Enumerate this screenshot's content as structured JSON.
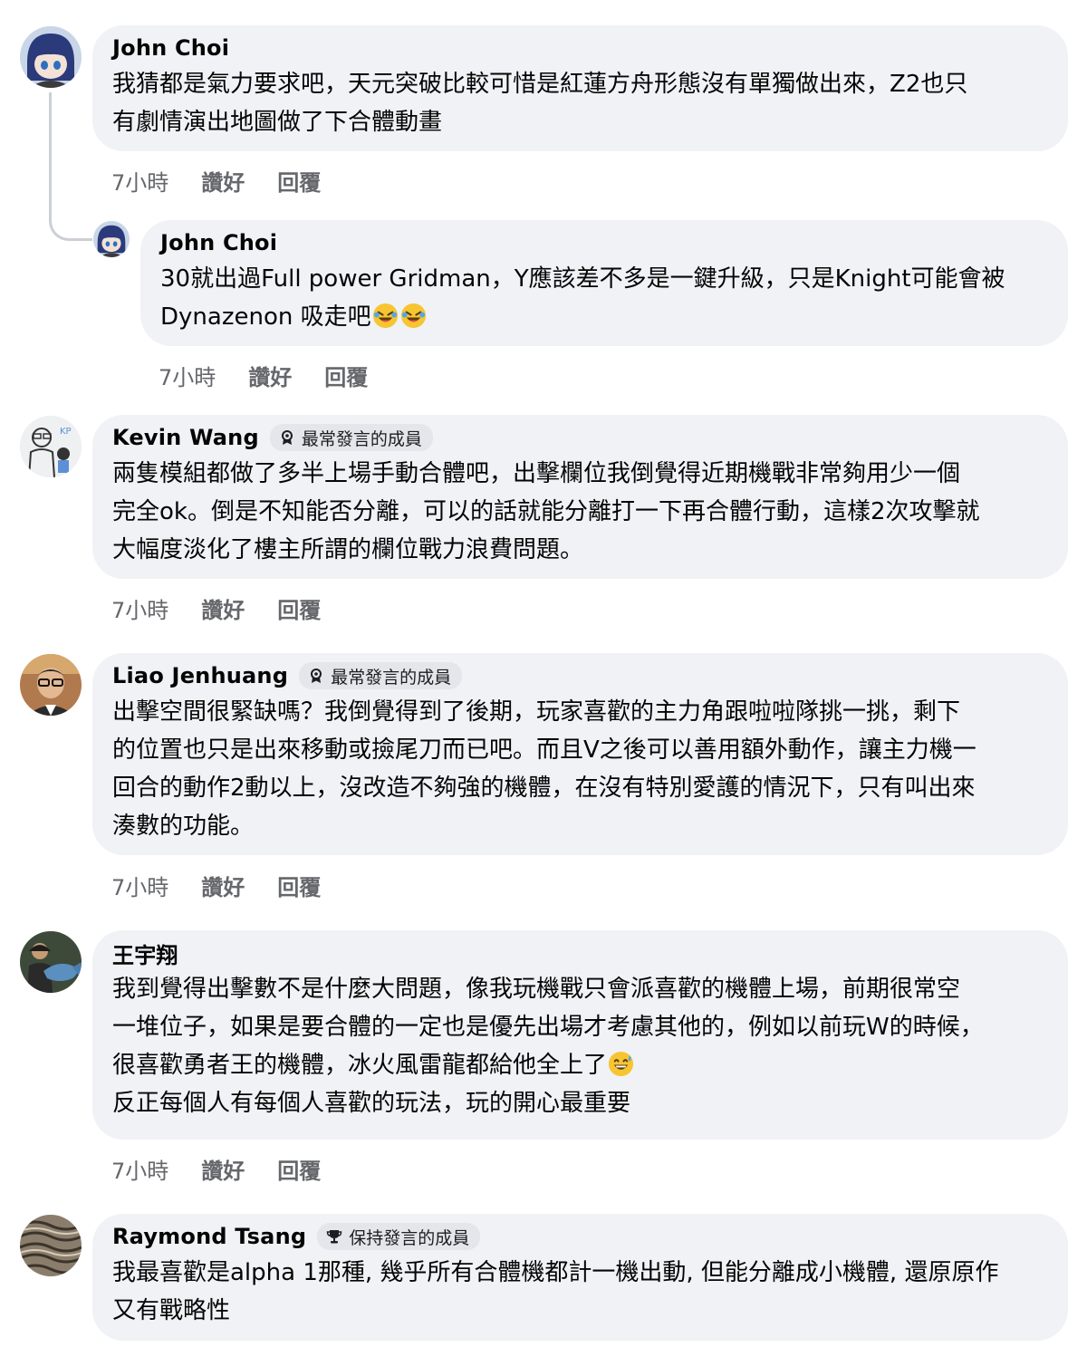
{
  "comments": [
    {
      "name": "John Choi",
      "badge": "",
      "text": "我猜都是氣力要求吧，天元突破比較可惜是紅蓮方舟形態沒有單獨做出來，Z2也只\n有劇情演出地圖做了下合體動畫",
      "time": "7小時",
      "like": "讚好",
      "reply": "回覆",
      "avatar_icon": "anime-avatar"
    },
    {
      "name": "John Choi",
      "badge": "",
      "text": "30就出過Full power Gridman，Y應該差不多是一鍵升級，只是Knight可能會被\nDynazenon 吸走吧",
      "emoji": [
        "rolling-laughing-emoji",
        "rolling-laughing-emoji"
      ],
      "time": "7小時",
      "like": "讚好",
      "reply": "回覆",
      "avatar_icon": "anime-avatar"
    },
    {
      "name": "Kevin Wang",
      "badge": "最常發言的成員",
      "text": "兩隻模組都做了多半上場手動合體吧，出擊欄位我倒覺得近期機戰非常夠用少一個\n完全ok。倒是不知能否分離，可以的話就能分離打一下再合體行動，這樣2次攻擊就\n大幅度淡化了樓主所謂的欄位戰力浪費問題。",
      "time": "7小時",
      "like": "讚好",
      "reply": "回覆",
      "avatar_icon": "sketch-avatar"
    },
    {
      "name": "Liao Jenhuang",
      "badge": "最常發言的成員",
      "text": "出擊空間很緊缺嗎？我倒覺得到了後期，玩家喜歡的主力角跟啦啦隊挑一挑，剩下\n的位置也只是出來移動或撿尾刀而已吧。而且V之後可以善用額外動作，讓主力機一\n回合的動作2動以上，沒改造不夠強的機體，在沒有特別愛護的情況下，只有叫出來\n湊數的功能。",
      "time": "7小時",
      "like": "讚好",
      "reply": "回覆",
      "avatar_icon": "photo-avatar"
    },
    {
      "name": "王宇翔",
      "badge": "",
      "text": "我到覺得出擊數不是什麼大問題，像我玩機戰只會派喜歡的機體上場，前期很常空\n一堆位子，如果是要合體的一定也是優先出場才考慮其他的，例如以前玩W的時候，\n很喜歡勇者王的機體，冰火風雷龍都給他全上了",
      "text2": "反正每個人有每個人喜歡的玩法，玩的開心最重要",
      "emoji": [
        "grinning-sweat-emoji"
      ],
      "time": "7小時",
      "like": "讚好",
      "reply": "回覆",
      "avatar_icon": "fish-photo-avatar"
    },
    {
      "name": "Raymond Tsang",
      "badge": "保持發言的成員",
      "text": "我最喜歡是alpha 1那種, 幾乎所有合體機都計一機出動, 但能分離成小機體, 還原原作\n又有戰略性",
      "avatar_icon": "texture-avatar"
    }
  ],
  "colors": {
    "bubble": "#f0f2f5",
    "badge": "#e4e6eb",
    "meta_text": "#65676b",
    "thread_line": "#ccd0d5"
  }
}
